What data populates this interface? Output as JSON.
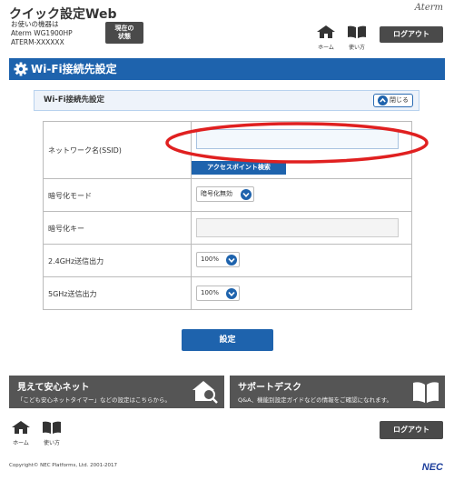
{
  "header": {
    "app_title": "クイック設定Web",
    "device_info_label": "お使いの機器は",
    "device_model": "Aterm WG1900HP",
    "device_ssid": "ATERM-XXXXXX",
    "status_button_line1": "現在の",
    "status_button_line2": "状態",
    "brand_logo": "Aterm",
    "home_label": "ホーム",
    "manual_label": "使い方",
    "logout_label": "ログアウト"
  },
  "section": {
    "title": "Wi-Fi接続先設定"
  },
  "panel": {
    "title": "Wi-Fi接続先設定",
    "close_label": "閉じる"
  },
  "form": {
    "ssid_label": "ネットワーク名(SSID)",
    "ssid_value": "",
    "ap_search_label": "アクセスポイント検索",
    "encryption_mode_label": "暗号化モード",
    "encryption_mode_value": "暗号化無効",
    "encryption_key_label": "暗号化キー",
    "encryption_key_value": "",
    "power_24_label": "2.4GHz送信出力",
    "power_24_value": "100%",
    "power_5_label": "5GHz送信出力",
    "power_5_value": "100%",
    "submit_label": "設定"
  },
  "banners": {
    "safety_title": "見えて安心ネット",
    "safety_desc": "「こども安心ネットタイマー」などの設定はこちらから。",
    "support_title": "サポートデスク",
    "support_desc": "Q&A、機能別設定ガイドなどの情報をご確認になれます。"
  },
  "footer": {
    "home_label": "ホーム",
    "manual_label": "使い方",
    "logout_label": "ログアウト",
    "copyright": "Copyright© NEC Platforms, Ltd. 2001-2017",
    "brand_logo": "NEC"
  },
  "colors": {
    "accent_blue": "#1e63ad",
    "dark_button": "#4a4a4a",
    "highlight_red": "#e02020"
  }
}
